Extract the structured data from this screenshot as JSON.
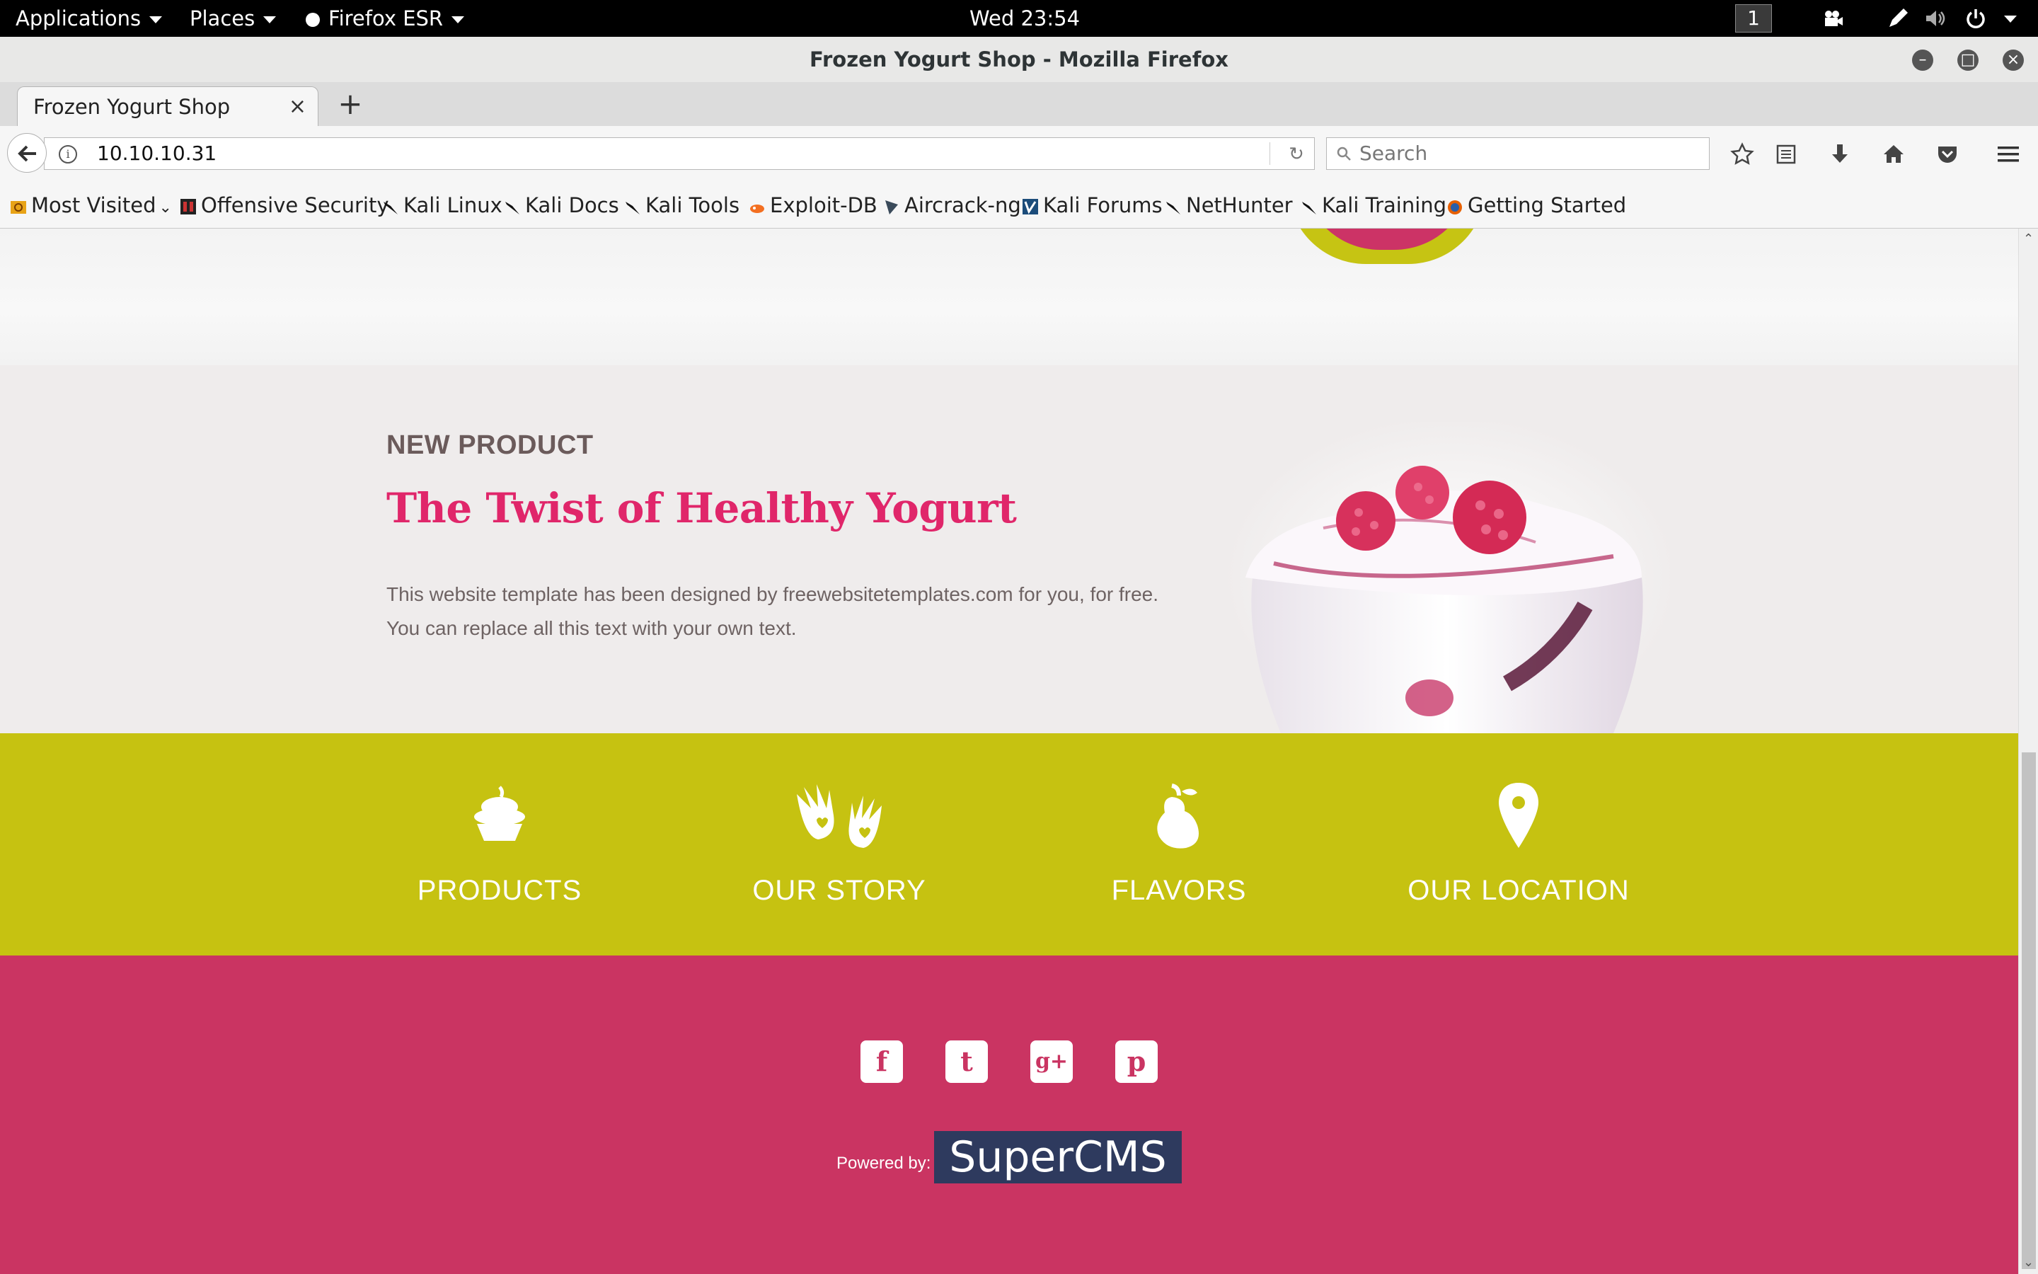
{
  "topbar": {
    "applications": "Applications",
    "places": "Places",
    "firefox": "Firefox ESR",
    "clock": "Wed 23:54",
    "workspace": "1"
  },
  "window": {
    "title": "Frozen Yogurt Shop - Mozilla Firefox"
  },
  "tab": {
    "title": "Frozen Yogurt Shop",
    "close": "×",
    "new_tab": "+"
  },
  "nav": {
    "url": "10.10.10.31",
    "search_placeholder": "Search"
  },
  "bookmarks": [
    {
      "label": "Most Visited",
      "icon": "folder-icon"
    },
    {
      "label": "Offensive Security",
      "icon": "offsec-icon"
    },
    {
      "label": "Kali Linux",
      "icon": "kali-icon"
    },
    {
      "label": "Kali Docs",
      "icon": "kali-icon"
    },
    {
      "label": "Kali Tools",
      "icon": "kali-icon"
    },
    {
      "label": "Exploit-DB",
      "icon": "exploitdb-icon"
    },
    {
      "label": "Aircrack-ng",
      "icon": "aircrack-icon"
    },
    {
      "label": "Kali Forums",
      "icon": "forums-icon"
    },
    {
      "label": "NetHunter",
      "icon": "kali-icon"
    },
    {
      "label": "Kali Training",
      "icon": "kali-icon"
    },
    {
      "label": "Getting Started",
      "icon": "firefox-icon"
    }
  ],
  "page": {
    "new_product_label": "NEW PRODUCT",
    "new_product_title": "The Twist of Healthy Yogurt",
    "new_product_desc": "This website template has been designed by freewebsitetemplates.com for you, for free. You can replace all this text with your own text.",
    "features": [
      {
        "label": "PRODUCTS",
        "icon": "cupcake-icon"
      },
      {
        "label": "OUR STORY",
        "icon": "hands-icon"
      },
      {
        "label": "FLAVORS",
        "icon": "pear-icon"
      },
      {
        "label": "OUR LOCATION",
        "icon": "map-pin-icon"
      }
    ],
    "social": [
      {
        "name": "facebook-icon",
        "glyph": "f"
      },
      {
        "name": "twitter-icon",
        "glyph": "t"
      },
      {
        "name": "google-plus-icon",
        "glyph": "g+"
      },
      {
        "name": "pinterest-icon",
        "glyph": "p"
      }
    ],
    "powered_by": "Powered by:",
    "cms": "SuperCMS"
  },
  "colors": {
    "features_bg": "#c6c211",
    "footer_bg": "#ca3462",
    "title_accent": "#e0266a"
  }
}
